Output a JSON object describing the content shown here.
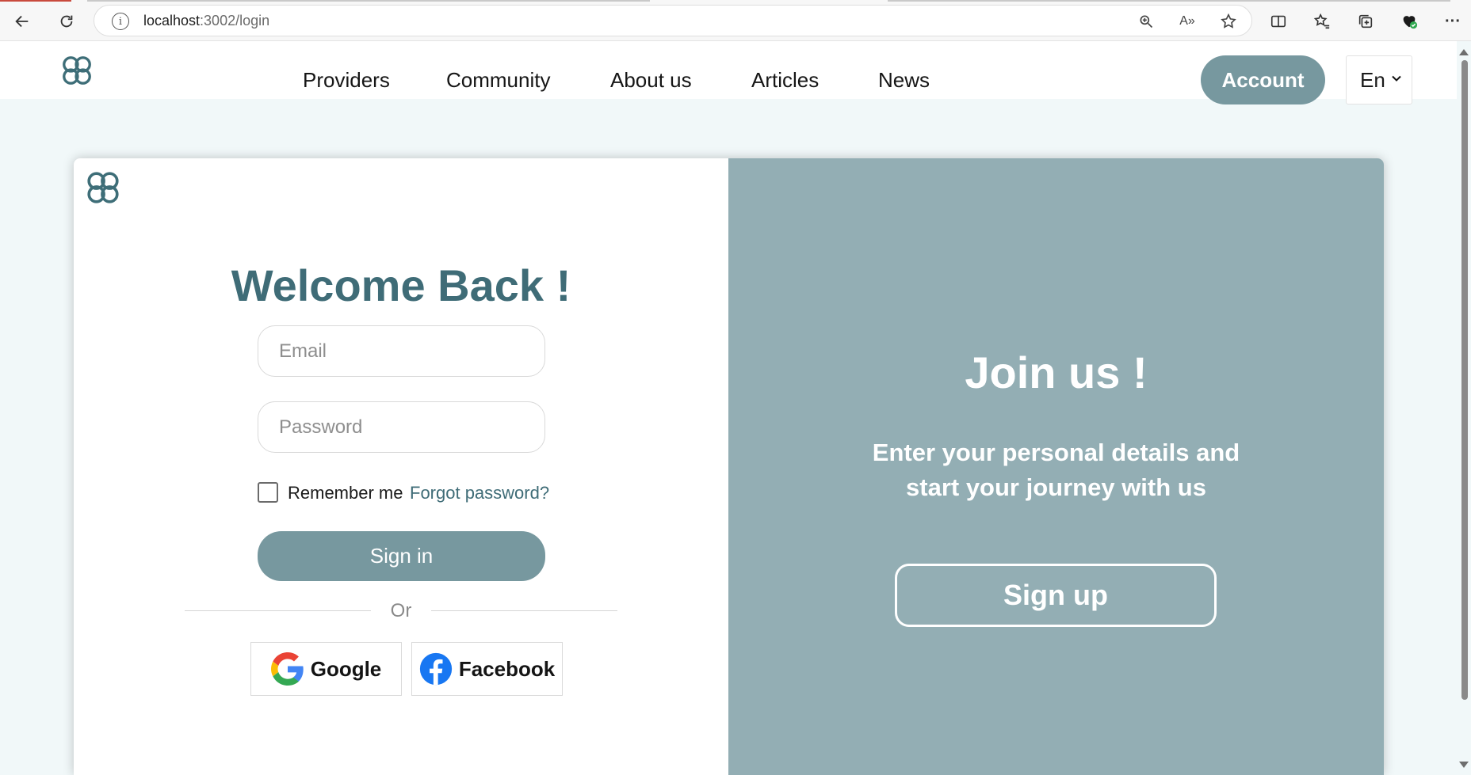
{
  "browser": {
    "url_host": "localhost",
    "url_rest": ":3002/login",
    "icons": [
      "back-arrow-icon",
      "reload-icon",
      "site-info-icon",
      "zoom-icon",
      "read-aloud-icon",
      "favorite-star-icon",
      "split-screen-icon",
      "favorites-icon",
      "collections-icon",
      "browser-essentials-icon",
      "more-icon"
    ],
    "read_aloud_label": "A»",
    "more_label": "···"
  },
  "nav": {
    "links": [
      "Providers",
      "Community",
      "About us",
      "Articles",
      "News"
    ],
    "account_label": "Account",
    "language": "En"
  },
  "login": {
    "title": "Welcome Back !",
    "email_placeholder": "Email",
    "password_placeholder": "Password",
    "remember_label": "Remember me",
    "forgot_label": "Forgot password?",
    "signin_label": "Sign in",
    "or_label": "Or",
    "google_label": "Google",
    "facebook_label": "Facebook"
  },
  "join": {
    "title": "Join us !",
    "subtitle": "Enter your personal details and start your journey with us",
    "signup_label": "Sign up"
  },
  "colors": {
    "accent": "#77989f",
    "panel": "#93aeb4",
    "heading": "#3f6c77",
    "page_bg": "#f1f8f9"
  }
}
